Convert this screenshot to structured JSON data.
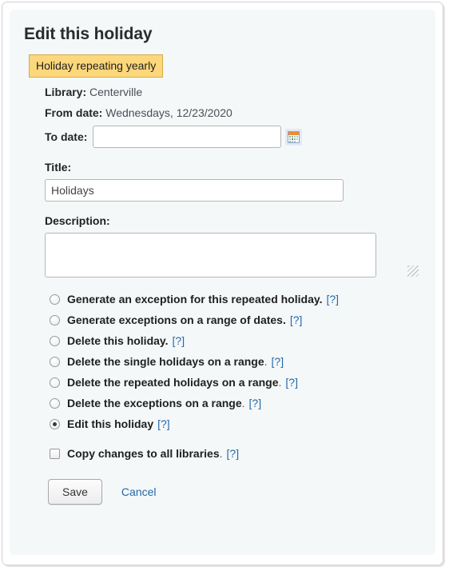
{
  "page": {
    "title": "Edit this holiday",
    "repeat_badge": "Holiday repeating yearly"
  },
  "details": {
    "library_label": "Library:",
    "library_value": "Centerville",
    "from_date_label": "From date:",
    "from_date_value": "Wednesdays, 12/23/2020",
    "to_date_label": "To date:",
    "to_date_value": "",
    "to_date_placeholder": "",
    "calendar_icon": "calendar-icon"
  },
  "fields": {
    "title_label": "Title:",
    "title_value": "Holidays",
    "title_placeholder": "",
    "description_label": "Description:",
    "description_value": "",
    "description_placeholder": ""
  },
  "options": [
    {
      "id": "generate-exception",
      "type": "radio",
      "label": "Generate an exception for this repeated holiday.",
      "tail": "",
      "help": "[?]",
      "checked": false
    },
    {
      "id": "generate-exceptions-range",
      "type": "radio",
      "label": "Generate exceptions on a range of dates.",
      "tail": "",
      "help": "[?]",
      "checked": false
    },
    {
      "id": "delete-this-holiday",
      "type": "radio",
      "label": "Delete this holiday.",
      "tail": "",
      "help": "[?]",
      "checked": false
    },
    {
      "id": "delete-single-holidays-range",
      "type": "radio",
      "label": "Delete the single holidays on a range",
      "tail": ".",
      "help": "[?]",
      "checked": false
    },
    {
      "id": "delete-repeated-holidays-range",
      "type": "radio",
      "label": "Delete the repeated holidays on a range",
      "tail": ".",
      "help": "[?]",
      "checked": false
    },
    {
      "id": "delete-exceptions-range",
      "type": "radio",
      "label": "Delete the exceptions on a range",
      "tail": ".",
      "help": "[?]",
      "checked": false
    },
    {
      "id": "edit-this-holiday",
      "type": "radio",
      "label": "Edit this holiday",
      "tail": "",
      "help": "[?]",
      "checked": true
    },
    {
      "id": "copy-changes-all-libraries",
      "type": "checkbox",
      "label": "Copy changes to all libraries",
      "tail": ".",
      "help": "[?]",
      "checked": false
    }
  ],
  "actions": {
    "save_label": "Save",
    "cancel_label": "Cancel"
  },
  "colors": {
    "panel_bg": "#f4f8f9",
    "badge_bg": "#fcd77b",
    "badge_border": "#d2ab4e",
    "link": "#2668a8",
    "text": "#1f1f1f"
  }
}
